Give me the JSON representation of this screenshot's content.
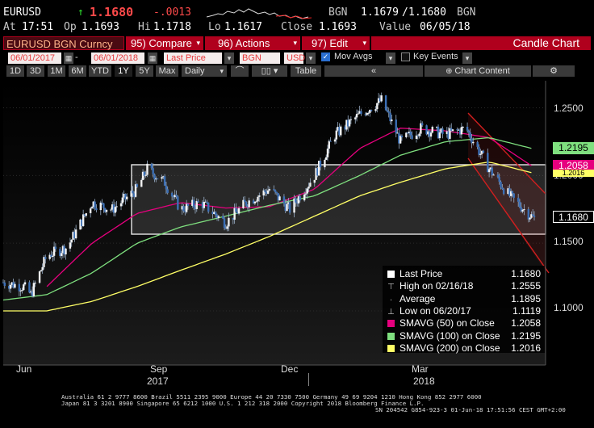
{
  "header": {
    "ticker": "EURUSD",
    "arrow": "↑",
    "last": "1.1680",
    "change": "-.0013",
    "source1": "BGN",
    "bid": "1.1679",
    "slash": "/",
    "ask": "1.1680",
    "source2": "BGN",
    "at_label": "At",
    "at_value": "17:51",
    "op_label": "Op",
    "op_value": "1.1693",
    "hi_label": "Hi",
    "hi_value": "1.1718",
    "lo_label": "Lo",
    "lo_value": "1.1617",
    "close_label": "Close",
    "close_value": "1.1693",
    "value_label": "Value",
    "value_date": "06/05/18"
  },
  "menu": {
    "security": "EURUSD BGN Curncy",
    "compare": "95) Compare",
    "actions": "96) Actions",
    "edit": "97) Edit",
    "title": "Candle Chart"
  },
  "controls": {
    "start_date": "06/01/2017",
    "end_date": "06/01/2018",
    "price_type": "Last Price",
    "source": "BGN",
    "currency": "USD",
    "mov_avgs_label": "Mov Avgs",
    "key_events_label": "Key Events",
    "periods": [
      "1D",
      "3D",
      "1M",
      "6M",
      "YTD",
      "1Y",
      "5Y",
      "Max"
    ],
    "selected_period": "1Y",
    "frequency": "Daily",
    "table_label": "Table",
    "chart_content_label": "Chart Content"
  },
  "price_boxes": {
    "sma100": "1.2195",
    "sma50": "1.2058",
    "sma200": "1.2016",
    "last": "1.1680"
  },
  "y_ticks": [
    "1.2500",
    "1.2000",
    "1.1500",
    "1.1000"
  ],
  "x_ticks": {
    "months": [
      "Jun",
      "Sep",
      "Dec",
      "Mar"
    ],
    "years": [
      "2017",
      "2018"
    ]
  },
  "legend": [
    {
      "label": "Last Price",
      "value": "1.1680",
      "color": "#ffffff",
      "marker": "square"
    },
    {
      "label": "High on 02/16/18",
      "value": "1.2555",
      "color": "#ffffff",
      "marker": "high"
    },
    {
      "label": "Average",
      "value": "1.1895",
      "color": "#ffffff",
      "marker": "avg"
    },
    {
      "label": "Low on 06/20/17",
      "value": "1.1119",
      "color": "#ffffff",
      "marker": "low"
    },
    {
      "label": "SMAVG (50) on Close",
      "value": "1.2058",
      "color": "#e6007e",
      "marker": "square"
    },
    {
      "label": "SMAVG (100) on Close",
      "value": "1.2195",
      "color": "#7fe07f",
      "marker": "square"
    },
    {
      "label": "SMAVG (200) on Close",
      "value": "1.2016",
      "color": "#ffff66",
      "marker": "square"
    }
  ],
  "footer": {
    "line1": "Australia 61 2 9777 8600 Brazil 5511 2395 9000 Europe 44 20 7330 7500 Germany 49 69 9204 1210 Hong Kong 852 2977 6000",
    "line2": "Japan 81 3 3201 8900       Singapore 65 6212 1000       U.S. 1 212 318 2000           Copyright 2018 Bloomberg Finance L.P.",
    "line3": "SN 204542 G854-923-3 01-Jun-18 17:51:56 CEST GMT+2:00"
  },
  "colors": {
    "accent_red": "#b0001d",
    "price_up": "#e6e6e6",
    "sma50": "#e6007e",
    "sma100": "#7fe07f",
    "sma200": "#ffff66",
    "channel": "#d01f1f"
  },
  "chart_data": {
    "type": "candlestick",
    "title": "",
    "xlabel": "",
    "ylabel": "",
    "ylim": [
      1.06,
      1.27
    ],
    "x_range": [
      "2017-06-01",
      "2018-06-01"
    ],
    "series": [
      {
        "name": "Last Price",
        "points": [
          [
            "2017-06-01",
            1.121
          ],
          [
            "2017-06-15",
            1.118
          ],
          [
            "2017-06-20",
            1.1119
          ],
          [
            "2017-07-01",
            1.141
          ],
          [
            "2017-07-15",
            1.147
          ],
          [
            "2017-08-01",
            1.18
          ],
          [
            "2017-08-15",
            1.175
          ],
          [
            "2017-09-01",
            1.19
          ],
          [
            "2017-09-08",
            1.205
          ],
          [
            "2017-09-20",
            1.195
          ],
          [
            "2017-10-01",
            1.175
          ],
          [
            "2017-10-15",
            1.18
          ],
          [
            "2017-11-01",
            1.165
          ],
          [
            "2017-11-15",
            1.18
          ],
          [
            "2017-12-01",
            1.19
          ],
          [
            "2017-12-15",
            1.175
          ],
          [
            "2018-01-01",
            1.2
          ],
          [
            "2018-01-15",
            1.23
          ],
          [
            "2018-02-01",
            1.245
          ],
          [
            "2018-02-16",
            1.2555
          ],
          [
            "2018-03-01",
            1.225
          ],
          [
            "2018-03-15",
            1.235
          ],
          [
            "2018-04-01",
            1.23
          ],
          [
            "2018-04-15",
            1.235
          ],
          [
            "2018-05-01",
            1.205
          ],
          [
            "2018-05-15",
            1.185
          ],
          [
            "2018-06-01",
            1.168
          ]
        ]
      },
      {
        "name": "SMAVG (50) on Close",
        "points": [
          [
            "2017-07-01",
            1.118
          ],
          [
            "2017-08-01",
            1.15
          ],
          [
            "2017-09-01",
            1.172
          ],
          [
            "2017-10-01",
            1.18
          ],
          [
            "2017-11-01",
            1.176
          ],
          [
            "2017-12-01",
            1.177
          ],
          [
            "2018-01-01",
            1.19
          ],
          [
            "2018-02-01",
            1.22
          ],
          [
            "2018-03-01",
            1.235
          ],
          [
            "2018-04-01",
            1.233
          ],
          [
            "2018-05-01",
            1.228
          ],
          [
            "2018-06-01",
            1.2058
          ]
        ]
      },
      {
        "name": "SMAVG (100) on Close",
        "points": [
          [
            "2017-06-01",
            1.108
          ],
          [
            "2017-07-01",
            1.112
          ],
          [
            "2017-08-01",
            1.128
          ],
          [
            "2017-09-01",
            1.15
          ],
          [
            "2017-10-01",
            1.162
          ],
          [
            "2017-11-01",
            1.17
          ],
          [
            "2017-12-01",
            1.178
          ],
          [
            "2018-01-01",
            1.185
          ],
          [
            "2018-02-01",
            1.2
          ],
          [
            "2018-03-01",
            1.215
          ],
          [
            "2018-04-01",
            1.225
          ],
          [
            "2018-05-01",
            1.228
          ],
          [
            "2018-06-01",
            1.2195
          ]
        ]
      },
      {
        "name": "SMAVG (200) on Close",
        "points": [
          [
            "2017-06-01",
            1.1
          ],
          [
            "2017-07-01",
            1.1
          ],
          [
            "2017-08-01",
            1.107
          ],
          [
            "2017-09-01",
            1.118
          ],
          [
            "2017-10-01",
            1.13
          ],
          [
            "2017-11-01",
            1.142
          ],
          [
            "2017-12-01",
            1.155
          ],
          [
            "2018-01-01",
            1.17
          ],
          [
            "2018-02-01",
            1.185
          ],
          [
            "2018-03-01",
            1.195
          ],
          [
            "2018-04-01",
            1.205
          ],
          [
            "2018-05-01",
            1.21
          ],
          [
            "2018-06-01",
            1.2016
          ]
        ]
      }
    ]
  }
}
